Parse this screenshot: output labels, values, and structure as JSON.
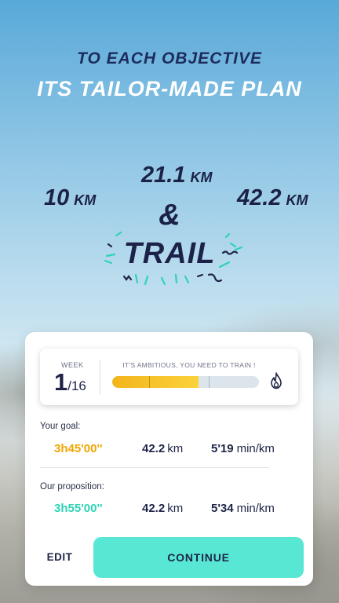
{
  "hero": {
    "line1": "TO EACH OBJECTIVE",
    "line2": "ITS TAILOR-MADE PLAN"
  },
  "distances": {
    "d10": {
      "num": "10",
      "unit": "KM"
    },
    "d21": {
      "num": "21.1",
      "unit": "KM"
    },
    "d42": {
      "num": "42.2",
      "unit": "KM"
    },
    "amp": "&",
    "trail": "TRAIL"
  },
  "card": {
    "week": {
      "label": "WEEK",
      "current": "1",
      "total": "/16"
    },
    "ambition_text": "IT'S AMBITIOUS, YOU NEED TO TRAIN !",
    "progress": {
      "fill_fraction": 0.59,
      "marker1": 0.25,
      "marker2": 0.66
    },
    "flame_icon": "flame-icon",
    "goal": {
      "label": "Your goal:",
      "time": "3h45'00''",
      "km": "42.2",
      "km_unit": "km",
      "pace": "5'19",
      "pace_unit": "min/km"
    },
    "proposition": {
      "label": "Our proposition:",
      "time": "3h55'00''",
      "km": "42.2",
      "km_unit": "km",
      "pace": "5'34",
      "pace_unit": "min/km"
    },
    "edit_label": "EDIT",
    "continue_label": "CONTINUE"
  },
  "colors": {
    "accent_teal": "#58e7d3",
    "goal_orange": "#f0a500",
    "prop_teal": "#2ed3b7",
    "navy": "#1e2447"
  }
}
